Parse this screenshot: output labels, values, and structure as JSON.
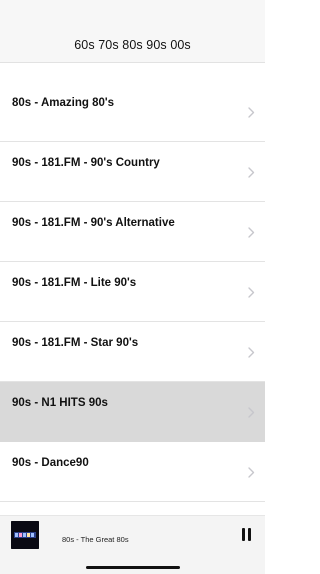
{
  "header": {
    "title": "60s 70s 80s 90s 00s"
  },
  "stations": [
    {
      "label": "80s - Amazing 80's",
      "selected": false
    },
    {
      "label": "90s - 181.FM - 90's Country",
      "selected": false
    },
    {
      "label": "90s - 181.FM - 90's Alternative",
      "selected": false
    },
    {
      "label": "90s - 181.FM - Lite 90's",
      "selected": false
    },
    {
      "label": "90s - 181.FM - Star 90's",
      "selected": false
    },
    {
      "label": "90s - N1 HITS 90s",
      "selected": true
    },
    {
      "label": "90s - Dance90",
      "selected": false
    }
  ],
  "player": {
    "now_playing": "80s - The Great 80s",
    "state": "playing",
    "control_icon": "pause-icon"
  },
  "icons": {
    "row_accessory": "chevron-right-icon"
  },
  "colors": {
    "nav_background": "#f7f7f7",
    "selected_row": "#d9d9d9",
    "divider": "#e3e3e3",
    "chevron": "#c7c7cc",
    "player_background": "#f4f4f4"
  }
}
